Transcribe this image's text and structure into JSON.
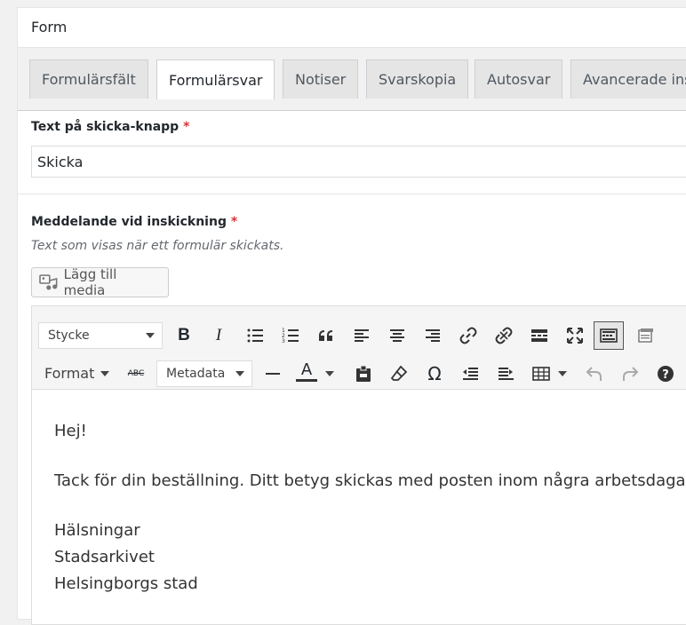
{
  "panel": {
    "title": "Form"
  },
  "tabs": [
    {
      "label": "Formulärsfält",
      "active": false
    },
    {
      "label": "Formulärsvar",
      "active": true
    },
    {
      "label": "Notiser",
      "active": false
    },
    {
      "label": "Svarskopia",
      "active": false
    },
    {
      "label": "Autosvar",
      "active": false
    },
    {
      "label": "Avancerade ins",
      "active": false
    }
  ],
  "submit_field": {
    "label": "Text på skicka-knapp",
    "required": "*",
    "value": "Skicka"
  },
  "message_field": {
    "label": "Meddelande vid inskickning",
    "required": "*",
    "description": "Text som visas när ett formulär skickats."
  },
  "media_button": {
    "label": "Lägg till media"
  },
  "toolbar": {
    "paragraph_select": "Stycke",
    "format_menu": "Format",
    "strikethrough_label": "ABC",
    "metadata_select": "Metadata",
    "text_color_letter": "A",
    "omega": "Ω"
  },
  "editor": {
    "lines_block1": [
      "Hej!"
    ],
    "lines_block2": [
      "Tack för din beställning. Ditt betyg skickas med posten inom några arbetsdagar."
    ],
    "lines_block3": [
      "Hälsningar",
      "Stadsarkivet",
      "Helsingborgs stad"
    ]
  }
}
